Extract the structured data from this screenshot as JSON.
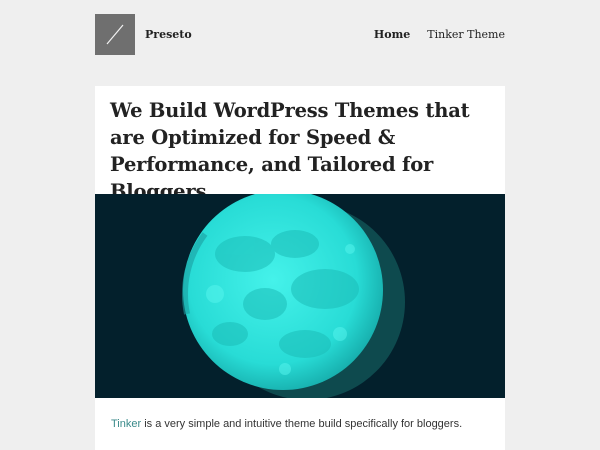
{
  "site": {
    "name": "Preseto"
  },
  "nav": {
    "items": [
      {
        "label": "Home",
        "active": true
      },
      {
        "label": "Tinker Theme",
        "active": false
      }
    ]
  },
  "post": {
    "title": "We Build WordPress Themes that are Optimized for Speed & Performance, and Tailored for Bloggers",
    "excerpt_link": "Tinker",
    "excerpt_rest": " is a very simple and intuitive theme build specifically for bloggers."
  },
  "colors": {
    "page_bg": "#efefef",
    "logo_bg": "#6f6f6f",
    "hero_bg": "#03202c",
    "moon": "#2ee6e0",
    "link": "#3a8a8a"
  },
  "icons": {
    "logo": "slash-logo-icon",
    "hero": "moon-image"
  }
}
